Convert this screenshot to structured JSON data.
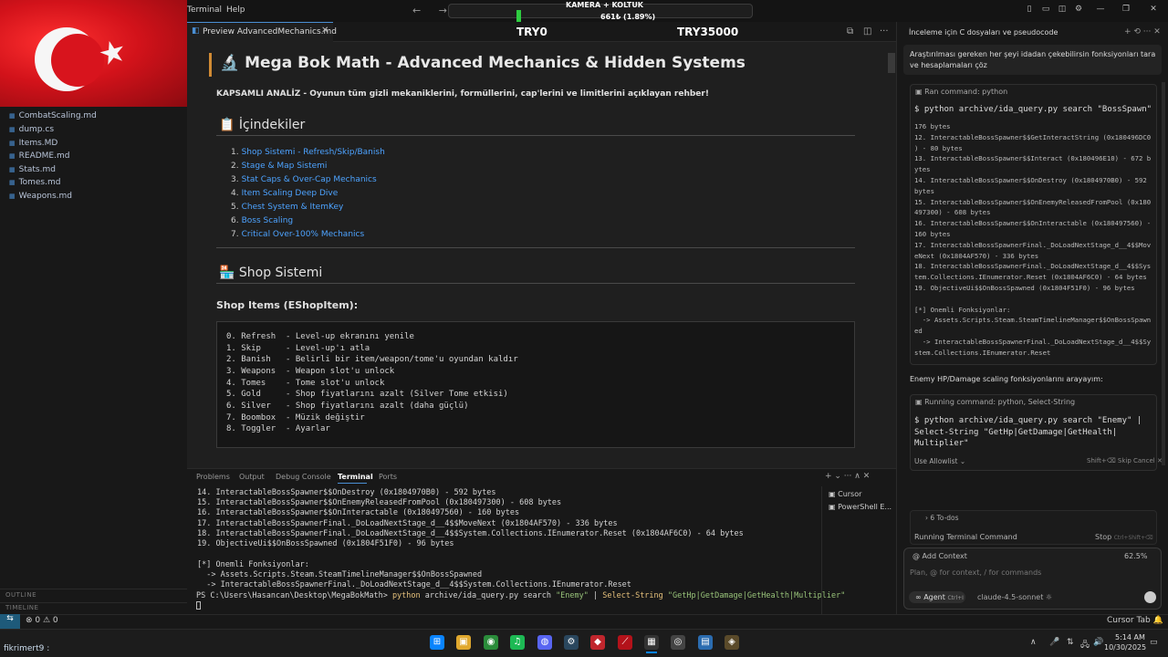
{
  "titlebar": {
    "menu": [
      "Terminal",
      "Help"
    ],
    "nav_arrows": "← →",
    "overlay_line1": "KAMERA + KOLTUK",
    "overlay_line2": "661₺ (1.89%)"
  },
  "flag": {
    "star": "★"
  },
  "sidebar": {
    "files": [
      "CombatScaling.md",
      "dump.cs",
      "Items.MD",
      "README.md",
      "Stats.md",
      "Tomes.md",
      "Weapons.md"
    ],
    "file_icon": "▦",
    "outline": "OUTLINE",
    "timeline": "TIMELINE"
  },
  "editor": {
    "tab_label": "Preview AdvancedMechanics.md",
    "tab_close": "✕",
    "tab_icon": "◧",
    "try0": "TRY0",
    "try35000": "TRY35000",
    "preview": {
      "h1_icon": "🔬",
      "h1": "Mega Bok Math - Advanced Mechanics & Hidden Systems",
      "subtitle": "KAPSAMLI ANALİZ - Oyunun tüm gizli mekaniklerini, formüllerini, cap'lerini ve limitlerini açıklayan rehber!",
      "toc_heading": "📋 İçindekiler",
      "toc": [
        {
          "n": "1.",
          "label": "Shop Sistemi - Refresh/Skip/Banish"
        },
        {
          "n": "2.",
          "label": "Stage & Map Sistemi"
        },
        {
          "n": "3.",
          "label": "Stat Caps & Over-Cap Mechanics"
        },
        {
          "n": "4.",
          "label": "Item Scaling Deep Dive"
        },
        {
          "n": "5.",
          "label": "Chest System & ItemKey"
        },
        {
          "n": "6.",
          "label": "Boss Scaling"
        },
        {
          "n": "7.",
          "label": "Critical Over-100% Mechanics"
        }
      ],
      "shop_heading": "🏪 Shop Sistemi",
      "shop_items_heading": "Shop Items (EShopItem):",
      "code_lines": [
        "0. Refresh  - Level-up ekranını yenile",
        "1. Skip     - Level-up'ı atla",
        "2. Banish   - Belirli bir item/weapon/tome'u oyundan kaldır",
        "3. Weapons  - Weapon slot'u unlock",
        "4. Tomes    - Tome slot'u unlock",
        "5. Gold     - Shop fiyatlarını azalt (Silver Tome etkisi)",
        "6. Silver   - Shop fiyatlarını azalt (daha güçlü)",
        "7. Boombox  - Müzik değiştir",
        "8. Toggler  - Ayarlar"
      ]
    }
  },
  "panel": {
    "tabs": [
      "Problems",
      "Output",
      "Debug Console",
      "Terminal",
      "Ports"
    ],
    "actions": "+ ⌄  ···  ∧  ✕",
    "terminal_lines": [
      "14. InteractableBossSpawner$$OnDestroy (0x1804970B0) - 592 bytes",
      "15. InteractableBossSpawner$$OnEnemyReleasedFromPool (0x180497300) - 608 bytes",
      "16. InteractableBossSpawner$$OnInteractable (0x180497560) - 160 bytes",
      "17. InteractableBossSpawnerFinal._DoLoadNextStage_d__4$$MoveNext (0x1804AF570) - 336 bytes",
      "18. InteractableBossSpawnerFinal._DoLoadNextStage_d__4$$System.Collections.IEnumerator.Reset (0x1804AF6C0) - 64 bytes",
      "19. ObjectiveUi$$OnBossSpawned (0x1804F51F0) - 96 bytes",
      "",
      "[*] Onemli Fonksiyonlar:",
      "  -> Assets.Scripts.Steam.SteamTimelineManager$$OnBossSpawned",
      "  -> InteractableBossSpawnerFinal._DoLoadNextStage_d__4$$System.Collections.IEnumerator.Reset"
    ],
    "prompt": "PS C:\\Users\\Hasancan\\Desktop\\MegaBokMath> ",
    "cmd_python": "python",
    "cmd_mid": " archive/ida_query.py search ",
    "cmd_str1": "\"Enemy\"",
    "cmd_pipe": " | ",
    "cmd_select": "Select-String",
    "cmd_str2": " \"GetHp|GetDamage|GetHealth|Multiplier\"",
    "sessions": [
      "Cursor",
      "PowerShell E..."
    ]
  },
  "chat": {
    "title": "İnceleme için C dosyaları ve pseudocode",
    "header_actions": "+  ⟲  ···  ✕",
    "user_message": "Araştırılması gereken her şeyi idadan çekebilirsin fonksiyonları tara ve hesaplamaları çöz",
    "tool1_header": "Ran command: python",
    "tool1_cmd": "$ python archive/ida_query.py search \"BossSpawn\"",
    "tool1_output": "176 bytes\n12. InteractableBossSpawner$$GetInteractString (0x180496DC0\n) - 80 bytes\n13. InteractableBossSpawner$$Interact (0x180496E10) - 672 b\nytes\n14. InteractableBossSpawner$$OnDestroy (0x1804970B0) - 592\nbytes\n15. InteractableBossSpawner$$OnEnemyReleasedFromPool (0x180\n497300) - 608 bytes\n16. InteractableBossSpawner$$OnInteractable (0x180497560) -\n160 bytes\n17. InteractableBossSpawnerFinal._DoLoadNextStage_d__4$$Mov\neNext (0x1804AF570) - 336 bytes\n18. InteractableBossSpawnerFinal._DoLoadNextStage_d__4$$Sys\ntem.Collections.IEnumerator.Reset (0x1804AF6C0) - 64 bytes\n19. ObjectiveUi$$OnBossSpawned (0x1804F51F0) - 96 bytes\n\n[*] Onemli Fonksiyonlar:\n  -> Assets.Scripts.Steam.SteamTimelineManager$$OnBossSpawn\ned\n  -> InteractableBossSpawnerFinal._DoLoadNextStage_d__4$$Sy\nstem.Collections.IEnumerator.Reset",
    "assistant_message": "Enemy HP/Damage scaling fonksiyonlarını arayayım:",
    "tool2_header": "Running command: python, Select-String",
    "tool2_cmd": "$ python archive/ida_query.py search \"Enemy\" |\nSelect-String \"GetHp|GetDamage|GetHealth|\nMultiplier\"",
    "use_allowlist": "Use Allowlist ⌄",
    "shift_enter": "Shift+⌫ Skip   Cancel ✕",
    "todos": "› 6 To-dos",
    "running_terminal": "Running Terminal Command",
    "stop": "Stop",
    "stop_shortcut": "Ctrl+Shift+⌫",
    "add_context": "@ Add Context",
    "context_pct": "62.5%",
    "input_placeholder": "Plan, @ for context, / for commands",
    "agent": "∞ Agent",
    "agent_shortcut": "Ctrl+I",
    "model": "claude-4.5-sonnet ☼"
  },
  "statusbar": {
    "remote": "⇆",
    "errors": "⊗ 0 ⚠ 0",
    "right": "Cursor Tab  🔔"
  },
  "taskbar": {
    "user": "fikrimert9 :",
    "time": "5:14 AM",
    "date": "10/30/2025",
    "apps": [
      "⊞",
      "▣",
      "◉",
      "♫",
      "◍",
      "⚙",
      "◆",
      "⟋",
      "▦",
      "◎",
      "▤",
      "◈"
    ],
    "tray": [
      "∧",
      "🎤",
      "⇅",
      "🖧",
      "🔊",
      "🔋"
    ],
    "accent": "#0a84ff"
  }
}
